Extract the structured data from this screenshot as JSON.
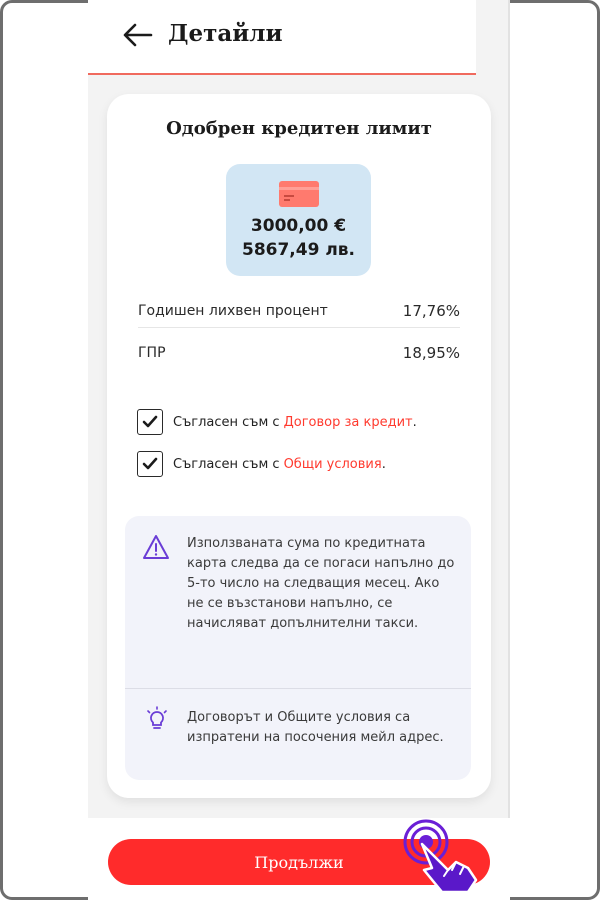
{
  "header": {
    "title": "Детайли"
  },
  "card": {
    "title": "Одобрен кредитен лимит",
    "amount_eur": "3000,00 €",
    "amount_bgn": "5867,49 лв.",
    "rows": [
      {
        "label": "Годишен лихвен процент",
        "value": "17,76%"
      },
      {
        "label": "ГПР",
        "value": "18,95%"
      }
    ],
    "agreements": [
      {
        "prefix": "Съгласен съм с",
        "link": "Договор за кредит",
        "suffix": ".",
        "checked": true
      },
      {
        "prefix": "Съгласен съм с",
        "link": "Общи условия",
        "suffix": ".",
        "checked": true
      }
    ],
    "info": {
      "warning_text": "Използваната сума по кредитната карта следва да се погаси напълно до 5-то число на следващия месец. Ако не се възстанови напълно, се начисляват допълнителни такси.",
      "tip_text": "Договорът и Общите условия са изпратени на посочения мейл адрес."
    }
  },
  "cta": {
    "label": "Продължи"
  },
  "colors": {
    "accent": "#ff2b2b",
    "link": "#ff3a2e",
    "limit_bg": "#d2e6f4",
    "info_bg": "#f2f3fa",
    "icon_purple": "#6a3dd6"
  },
  "icons": [
    "back-arrow-icon",
    "credit-card-icon",
    "checkmark-icon",
    "warning-triangle-icon",
    "lightbulb-icon",
    "tap-hand-icon"
  ]
}
